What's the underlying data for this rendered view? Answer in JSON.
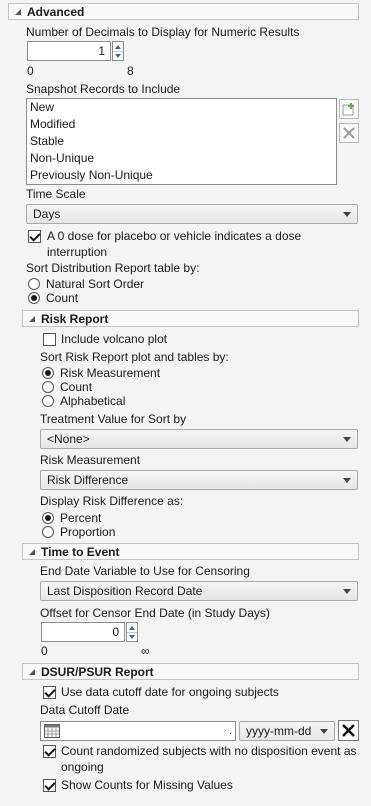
{
  "advanced": {
    "title": "Advanced",
    "decimals_label": "Number of Decimals to Display for Numeric Results",
    "decimals_value": "1",
    "decimals_min": "0",
    "decimals_max": "8",
    "snapshot_label": "Snapshot Records to Include",
    "snapshot_items": [
      "New",
      "Modified",
      "Stable",
      "Non-Unique",
      "Previously Non-Unique"
    ],
    "time_scale_label": "Time Scale",
    "time_scale_value": "Days",
    "zero_dose_label_1": "A 0 dose for placebo or vehicle indicates a dose",
    "zero_dose_label_2": "interruption",
    "zero_dose_checked": true,
    "sort_dist_label": "Sort Distribution Report table by:",
    "sort_dist_options": [
      "Natural Sort Order",
      "Count"
    ],
    "sort_dist_selected": "Count"
  },
  "risk": {
    "title": "Risk Report",
    "volcano_label": "Include volcano plot",
    "volcano_checked": false,
    "sort_label": "Sort Risk Report plot and tables by:",
    "sort_options": [
      "Risk Measurement",
      "Count",
      "Alphabetical"
    ],
    "sort_selected": "Risk Measurement",
    "treatment_label": "Treatment Value for Sort by",
    "treatment_value": "<None>",
    "measurement_label": "Risk Measurement",
    "measurement_value": "Risk Difference",
    "display_label": "Display Risk Difference as:",
    "display_options": [
      "Percent",
      "Proportion"
    ],
    "display_selected": "Percent"
  },
  "tte": {
    "title": "Time to Event",
    "end_date_label": "End Date Variable to Use for Censoring",
    "end_date_value": "Last Disposition Record Date",
    "offset_label": "Offset for Censor End Date (in Study Days)",
    "offset_value": "0",
    "offset_min": "0",
    "offset_max": "∞"
  },
  "dsur": {
    "title": "DSUR/PSUR Report",
    "cutoff_use_label": "Use data cutoff date for ongoing subjects",
    "cutoff_use_checked": true,
    "cutoff_label": "Data Cutoff Date",
    "cutoff_format": "yyyy-mm-dd",
    "count_rand_label_1": "Count randomized subjects with no disposition event as",
    "count_rand_label_2": "ongoing",
    "count_rand_checked": true,
    "missing_label": "Show Counts for Missing Values",
    "missing_checked": true
  }
}
